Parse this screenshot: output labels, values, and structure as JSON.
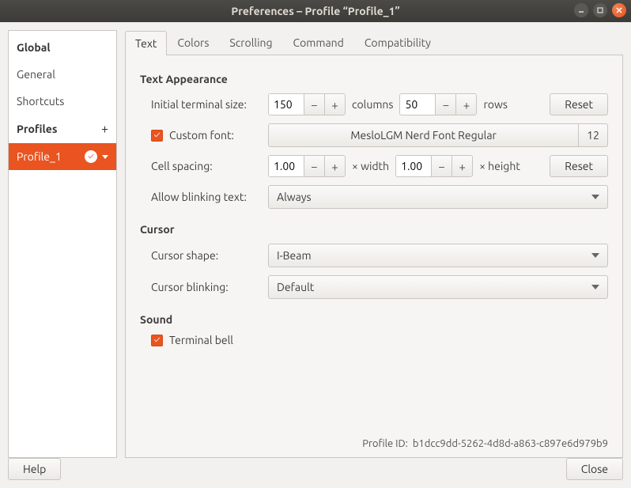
{
  "window": {
    "title": "Preferences – Profile “Profile_1”"
  },
  "sidebar": {
    "global": "Global",
    "general": "General",
    "shortcuts": "Shortcuts",
    "profiles_header": "Profiles",
    "profile_1": "Profile_1"
  },
  "tabs": {
    "text": "Text",
    "colors": "Colors",
    "scrolling": "Scrolling",
    "command": "Command",
    "compatibility": "Compatibility"
  },
  "text_appearance": {
    "heading": "Text Appearance",
    "initial_size_label": "Initial terminal size:",
    "cols_value": "150",
    "cols_label": "columns",
    "rows_value": "50",
    "rows_label": "rows",
    "reset_label": "Reset",
    "custom_font_label": "Custom font:",
    "font_name": "MesloLGM Nerd Font Regular",
    "font_size": "12",
    "cell_spacing_label": "Cell spacing:",
    "cell_w": "1.00",
    "cell_w_label": "× width",
    "cell_h": "1.00",
    "cell_h_label": "× height",
    "cell_reset": "Reset",
    "blink_label": "Allow blinking text:",
    "blink_value": "Always"
  },
  "cursor": {
    "heading": "Cursor",
    "shape_label": "Cursor shape:",
    "shape_value": "I-Beam",
    "blink_label": "Cursor blinking:",
    "blink_value": "Default"
  },
  "sound": {
    "heading": "Sound",
    "bell_label": "Terminal bell"
  },
  "profile_id": {
    "label": "Profile ID:",
    "value": "b1dcc9dd-5262-4d8d-a863-c897e6d979b9"
  },
  "footer": {
    "help": "Help",
    "close": "Close"
  }
}
